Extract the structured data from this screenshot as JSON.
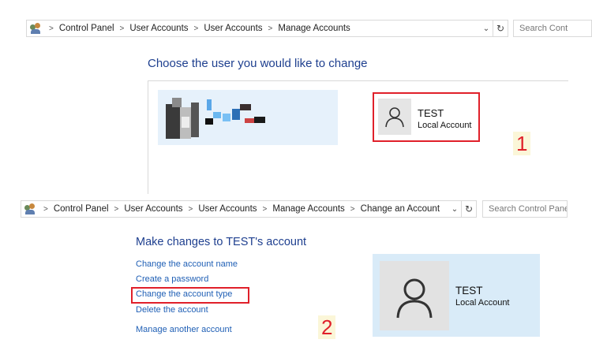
{
  "top": {
    "breadcrumb": [
      "Control Panel",
      "User Accounts",
      "User Accounts",
      "Manage Accounts"
    ],
    "search_placeholder": "Search Cont",
    "heading": "Choose the user you would like to change",
    "account": {
      "name": "TEST",
      "type": "Local Account"
    },
    "step_number": "1"
  },
  "bottom": {
    "breadcrumb": [
      "Control Panel",
      "User Accounts",
      "User Accounts",
      "Manage Accounts",
      "Change an Account"
    ],
    "search_placeholder": "Search Control Panel",
    "heading": "Make changes to TEST's account",
    "links": {
      "change_name": "Change the account name",
      "create_password": "Create a password",
      "change_type": "Change the account type",
      "delete": "Delete the account",
      "manage_another": "Manage another account"
    },
    "account": {
      "name": "TEST",
      "type": "Local Account"
    },
    "step_number": "2"
  },
  "colors": {
    "highlight": "#e0202a",
    "link": "#1f5fb5",
    "heading": "#1e3f8f",
    "tile_bg": "#d9ebf8"
  },
  "icons": [
    "control-panel-icon",
    "chevron-right-icon",
    "chevron-down-icon",
    "refresh-icon",
    "user-silhouette-icon"
  ]
}
